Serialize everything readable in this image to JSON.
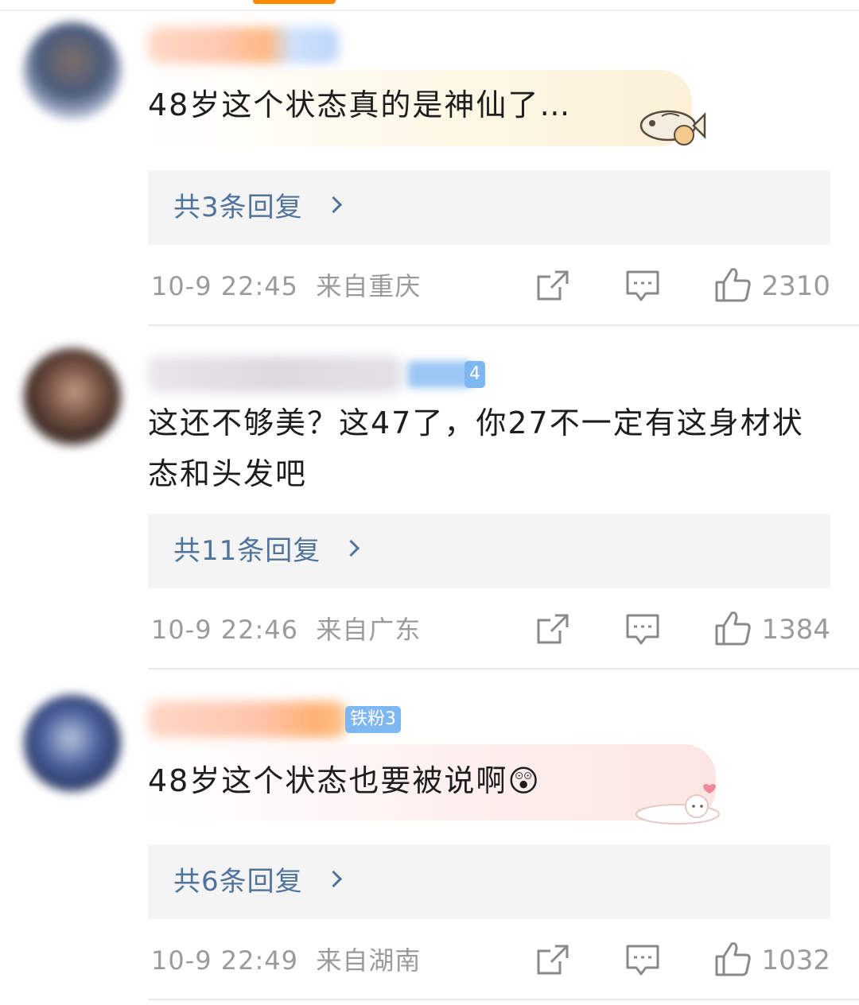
{
  "comments": [
    {
      "text": "48岁这个状态真的是神仙了…",
      "replies_label": "共3条回复",
      "timestamp": "10-9 22:45",
      "location": "来自重庆",
      "likes": "2310",
      "sticker": "fish-sticker-icon"
    },
    {
      "badge": "4",
      "text": "这还不够美？这47了，你27不一定有这身材状态和头发吧",
      "replies_label": "共11条回复",
      "timestamp": "10-9 22:46",
      "location": "来自广东",
      "likes": "1384"
    },
    {
      "badge": "铁粉3",
      "text": "48岁这个状态也要被说啊😲",
      "replies_label": "共6条回复",
      "timestamp": "10-9 22:49",
      "location": "来自湖南",
      "likes": "1032",
      "sticker": "cat-sticker-icon"
    }
  ],
  "icons": {
    "share": "share-icon",
    "comment": "comment-icon",
    "like": "like-icon"
  },
  "colors": {
    "reply_link": "#50739c",
    "meta_text": "#9b9b9b",
    "fan_badge": "#7fb7f2",
    "accent_bar": "#ff8a00"
  }
}
